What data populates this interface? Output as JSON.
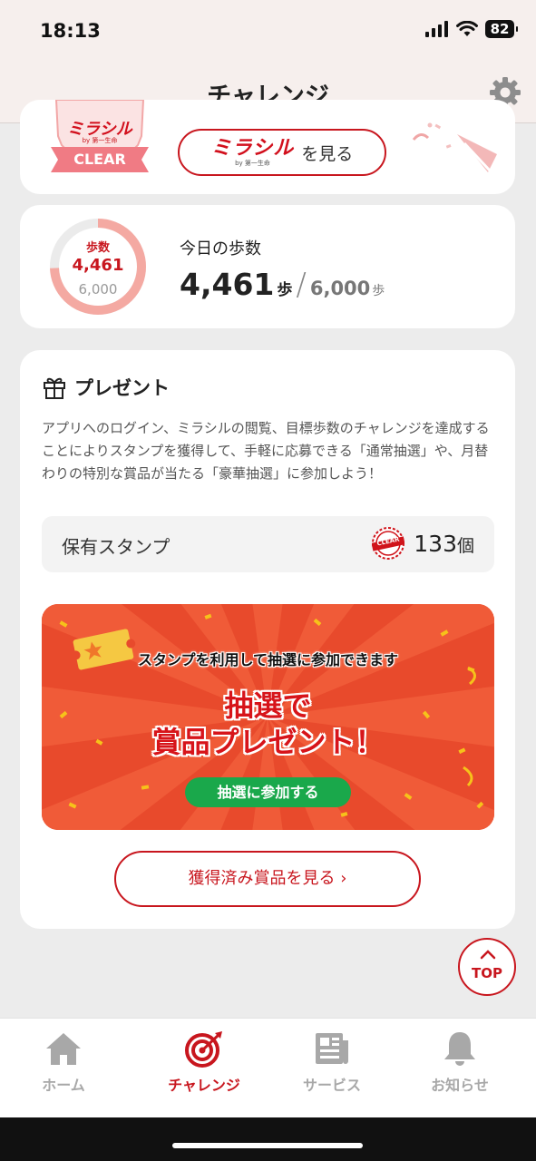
{
  "status_bar": {
    "time": "18:13",
    "battery": "82"
  },
  "header": {
    "title": "チャレンジ"
  },
  "mirashiru": {
    "badge_logo": "ミラシル",
    "badge_sub": "by 第一生命",
    "badge_text": "CLEAR",
    "button_logo": "ミラシル",
    "button_logo_sub": "by 第一生命",
    "button_text": "を見る"
  },
  "steps": {
    "ring_label": "歩数",
    "current": "4,461",
    "goal": "6,000",
    "progress": 0.7435,
    "heading": "今日の歩数",
    "unit": "歩",
    "slash": "/",
    "colors": {
      "ring": "#f4a9a2",
      "ring_track": "#ebebeb",
      "current_text": "#c8161e"
    }
  },
  "present": {
    "title": "プレゼント",
    "description": "アプリへのログイン、ミラシルの閲覧、目標歩数のチャレンジを達成することによりスタンプを獲得して、手軽に応募できる「通常抽選」や、月替わりの特別な賞品が当たる「豪華抽選」に参加しよう！",
    "stamp_label": "保有スタンプ",
    "stamp_badge": "CLEAR",
    "stamp_count": "133",
    "stamp_unit": "個",
    "banner": {
      "subtitle": "スタンプを利用して抽選に参加できます",
      "title_line1": "抽選で",
      "title_line2": "賞品プレゼント！",
      "button": "抽選に参加する"
    },
    "prizes_button": "獲得済み賞品を見る ›"
  },
  "top_button": {
    "label": "TOP"
  },
  "tabs": [
    {
      "label": "ホーム",
      "icon": "home-icon",
      "active": false
    },
    {
      "label": "チャレンジ",
      "icon": "target-icon",
      "active": true
    },
    {
      "label": "サービス",
      "icon": "newspaper-icon",
      "active": false
    },
    {
      "label": "お知らせ",
      "icon": "bell-icon",
      "active": false
    }
  ],
  "colors": {
    "brand_red": "#c8161e",
    "green": "#1aa84b",
    "banner_orange": "#e84a2c"
  }
}
